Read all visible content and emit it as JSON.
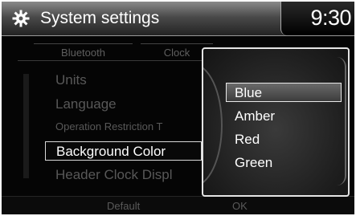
{
  "header": {
    "title": "System settings",
    "clock": "9:30",
    "icon": "gear-icon"
  },
  "tabs": [
    {
      "label": "Bluetooth"
    },
    {
      "label": "Clock"
    }
  ],
  "menu": {
    "items": [
      {
        "label": "Units"
      },
      {
        "label": "Language"
      },
      {
        "label": "Operation Restriction T"
      },
      {
        "label": "Background Color"
      },
      {
        "label": "Header Clock Displ"
      }
    ],
    "selected": "Background Color"
  },
  "popup": {
    "options": [
      {
        "label": "Blue"
      },
      {
        "label": "Amber"
      },
      {
        "label": "Red"
      },
      {
        "label": "Green"
      }
    ],
    "selected": "Blue"
  },
  "bottom": {
    "default_label": "Default",
    "ok_label": "OK"
  },
  "colors": {
    "text_active": "#ffffff",
    "text_dimmed": "#585858",
    "background": "#050505"
  }
}
